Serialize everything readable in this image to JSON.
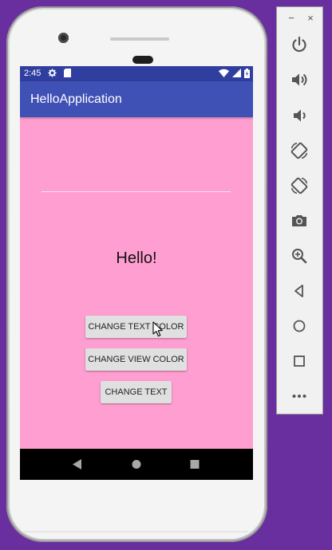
{
  "status_bar": {
    "time": "2:45"
  },
  "app": {
    "title": "HelloApplication"
  },
  "content": {
    "edit_text_value": "",
    "hello_text": "Hello!",
    "buttons": {
      "change_text_color": "CHANGE TEXT COLOR",
      "change_view_color": "CHANGE VIEW COLOR",
      "change_text": "CHANGE TEXT"
    }
  },
  "navigation": {
    "back_icon": "back-triangle-icon",
    "home_icon": "home-circle-icon",
    "recent_icon": "recent-square-icon"
  },
  "emulator_toolbar": {
    "minimize_label": "−",
    "close_label": "×",
    "items": [
      "power-icon",
      "volume-up-icon",
      "volume-down-icon",
      "rotate-left-icon",
      "rotate-right-icon",
      "camera-icon",
      "zoom-icon",
      "back-icon",
      "home-icon",
      "overview-icon",
      "more-icon"
    ]
  },
  "colors": {
    "desktop_background": "#6a2f9e",
    "app_bar": "#3f51b5",
    "status_bar": "#303f9f",
    "screen_background": "#ff9fd1",
    "button": "#e0e0e0"
  }
}
